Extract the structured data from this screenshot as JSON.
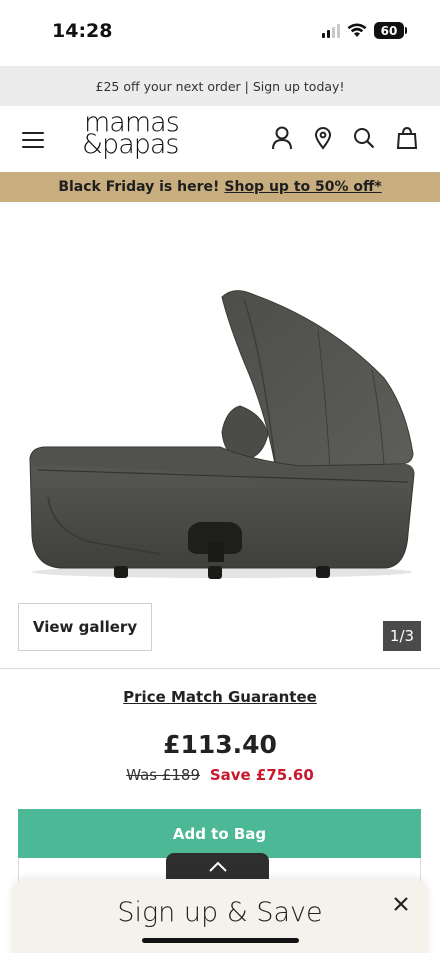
{
  "status_bar": {
    "time": "14:28",
    "battery_level": "60",
    "icons": [
      "signal-icon",
      "wifi-icon",
      "battery-icon"
    ]
  },
  "promo_bar": {
    "text": "£25 off your next order | Sign up today!"
  },
  "header": {
    "logo_line1": "mamas",
    "logo_line2": "&papas",
    "icons": [
      "menu-icon",
      "account-icon",
      "store-locator-icon",
      "search-icon",
      "bag-icon"
    ]
  },
  "black_friday": {
    "text": "Black Friday is here!",
    "link": "Shop up to 50% off*",
    "background": "#c8ad7f"
  },
  "product": {
    "image_alt": "Grey carrycot with hood",
    "view_gallery_label": "View gallery",
    "gallery_counter": "1/3",
    "price_match_label": "Price Match Guarantee",
    "price": "£113.40",
    "was_price": "Was £189",
    "save_text": "Save £75.60",
    "add_to_bag_label": "Add to Bag"
  },
  "colors": {
    "accent_green": "#4db896",
    "sale_red": "#c8182e",
    "promo_grey": "#ececec"
  },
  "signup_drawer": {
    "title": "Sign up & Save"
  }
}
